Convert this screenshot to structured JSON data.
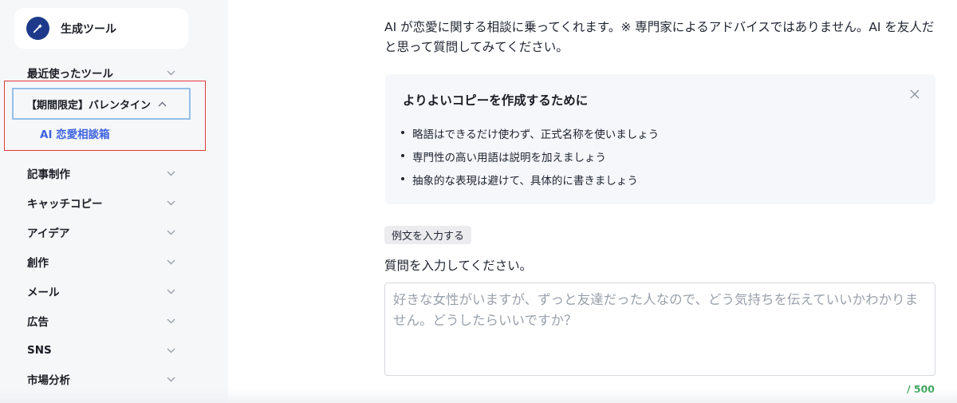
{
  "sidebar": {
    "brand_label": "生成ツール",
    "recent_label": "最近使ったツール",
    "active_group_label": "【期間限定】バレンタイン",
    "active_sub_label": "AI 恋愛相談箱",
    "categories": [
      "記事制作",
      "キャッチコピー",
      "アイデア",
      "創作",
      "メール",
      "広告",
      "SNS",
      "市場分析"
    ]
  },
  "main": {
    "intro": "AI が恋愛に関する相談に乗ってくれます。※ 専門家によるアドバイスではありません。AI を友人だと思って質問してみてください。",
    "tips": {
      "title": "よりよいコピーを作成するために",
      "items": [
        "略語はできるだけ使わず、正式名称を使いましょう",
        "専門性の高い用語は説明を加えましょう",
        "抽象的な表現は避けて、具体的に書きましょう"
      ]
    },
    "example_button": "例文を入力する",
    "question_label": "質問を入力してください。",
    "question_placeholder": "好きな女性がいますが、ずっと友達だった人なので、どう気持ちを伝えていいかわかりません。どうしたらいいですか？",
    "question_value": "",
    "char_counter": "/ 500"
  },
  "colors": {
    "accent_blue": "#3d63e0",
    "brand_icon_bg": "#1d3a8a",
    "highlight_red": "#e23b3b",
    "counter_green": "#3aa35b"
  },
  "icons": {
    "brand": "magic-wand-icon",
    "expand": "chevron-down-icon",
    "collapse": "chevron-up-icon",
    "close": "close-icon"
  }
}
